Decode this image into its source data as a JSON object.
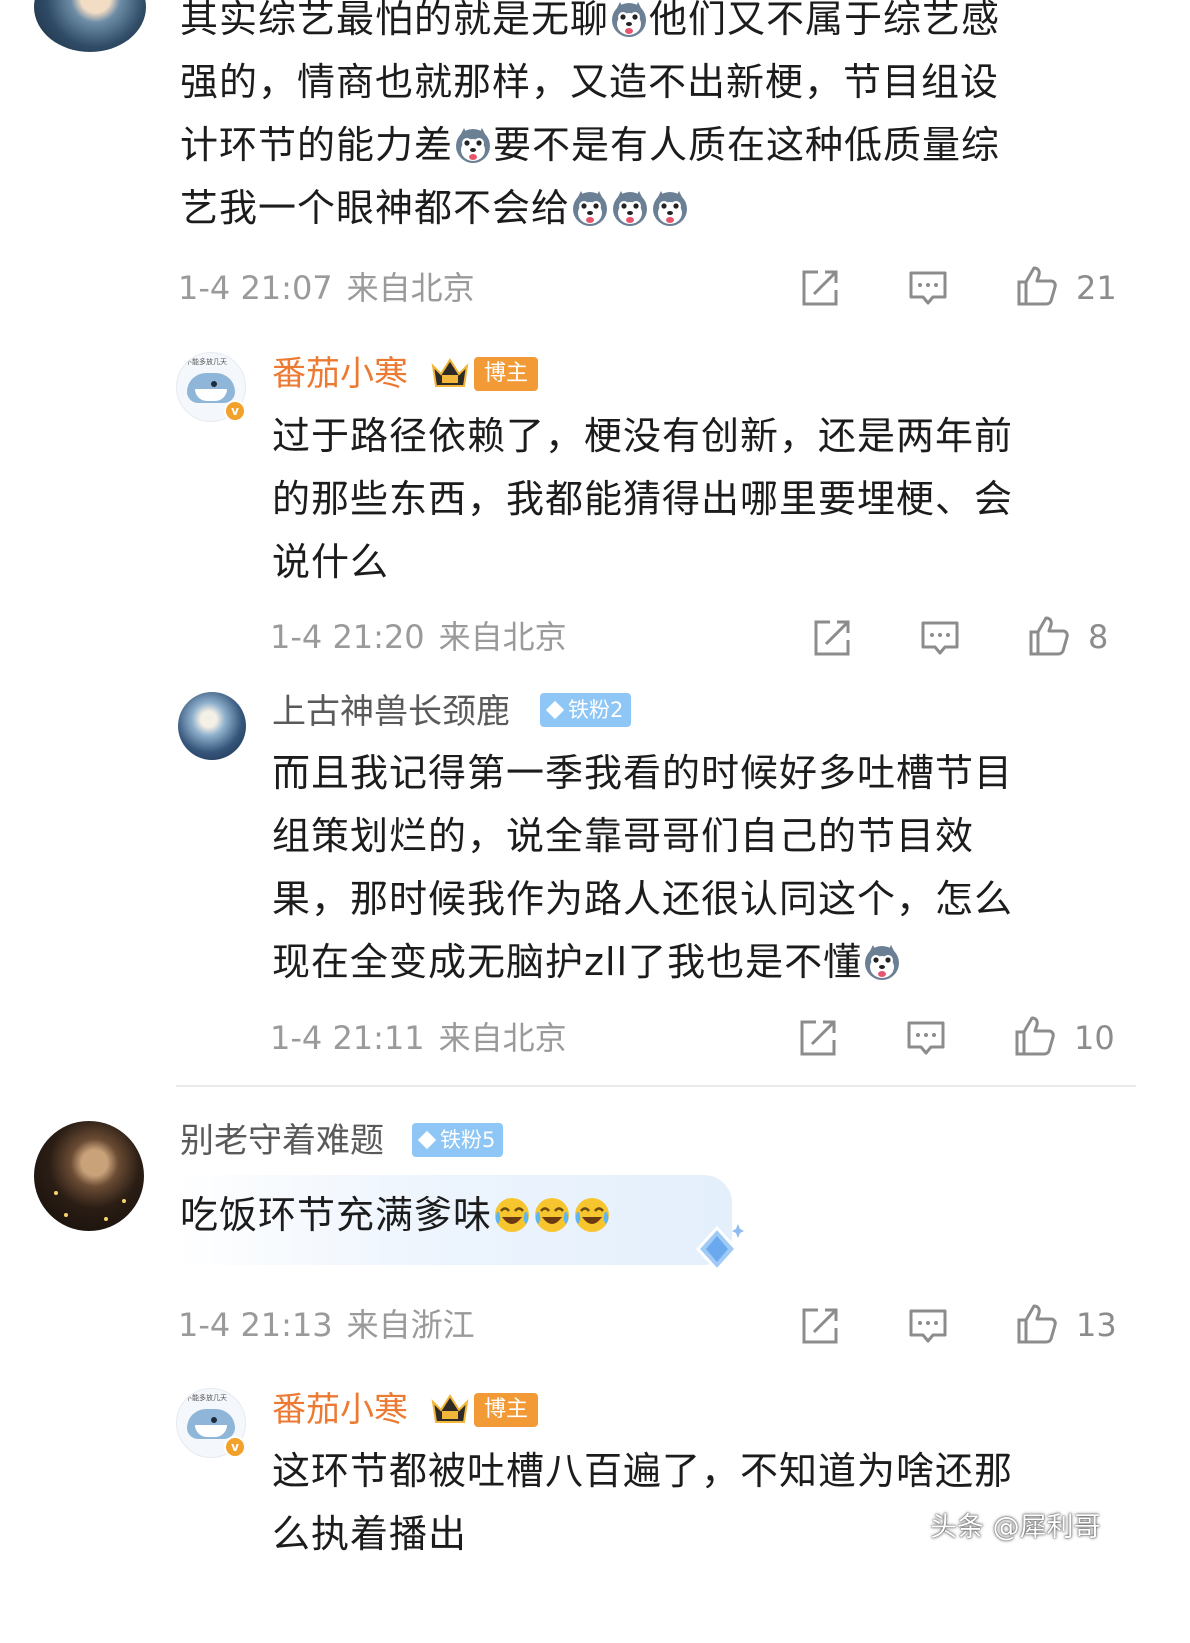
{
  "comments": [
    {
      "lines": [
        "其实综艺最怕的就是无聊",
        "他们又不属于综艺感",
        "强的，情商也就那样，又造不出新梗，节目组设",
        "计环节的能力差",
        "要不是有人质在这种低质量综",
        "艺我一个眼神都不会给"
      ],
      "time": "1-4 21:07",
      "location": "来自北京",
      "likes": "21"
    },
    {
      "username": "番茄小寒",
      "tag": "博主",
      "avatar_caption": "不能多放几天",
      "lines": [
        "过于路径依赖了，梗没有创新，还是两年前",
        "的那些东西，我都能猜得出哪里要埋梗、会",
        "说什么"
      ],
      "time": "1-4 21:20",
      "location": "来自北京",
      "likes": "8"
    },
    {
      "username": "上古神兽长颈鹿",
      "tag": "铁粉2",
      "lines": [
        "而且我记得第一季我看的时候好多吐槽节目",
        "组策划烂的，说全靠哥哥们自己的节目效",
        "果，那时候我作为路人还很认同这个，怎么",
        "现在全变成无脑护zll了我也是不懂"
      ],
      "time": "1-4 21:11",
      "location": "来自北京",
      "likes": "10"
    },
    {
      "username": "别老守着难题",
      "tag": "铁粉5",
      "lines": [
        "吃饭环节充满爹味"
      ],
      "time": "1-4 21:13",
      "location": "来自浙江",
      "likes": "13"
    },
    {
      "username": "番茄小寒",
      "tag": "博主",
      "avatar_caption": "不能多放几天",
      "lines": [
        "这环节都被吐槽八百遍了，不知道为啥还那",
        "么执着播出"
      ]
    }
  ],
  "icons": {
    "share": "share-icon",
    "comment": "comment-icon",
    "like": "thumbs-up-icon",
    "emoji_dog": "husky-emoji-icon",
    "emoji_laugh": "laugh-cry-emoji-icon",
    "crown": "crown-icon",
    "fan_gem": "diamond-icon",
    "verified": "verified-v-icon"
  },
  "colors": {
    "author_name": "#ec7a33",
    "author_tag": "#f29a35",
    "fan_tag": "#8ec6f5",
    "meta_text": "#9a9a9a",
    "icon_stroke": "#8c8c8c"
  },
  "watermark": "头条 @犀利哥"
}
